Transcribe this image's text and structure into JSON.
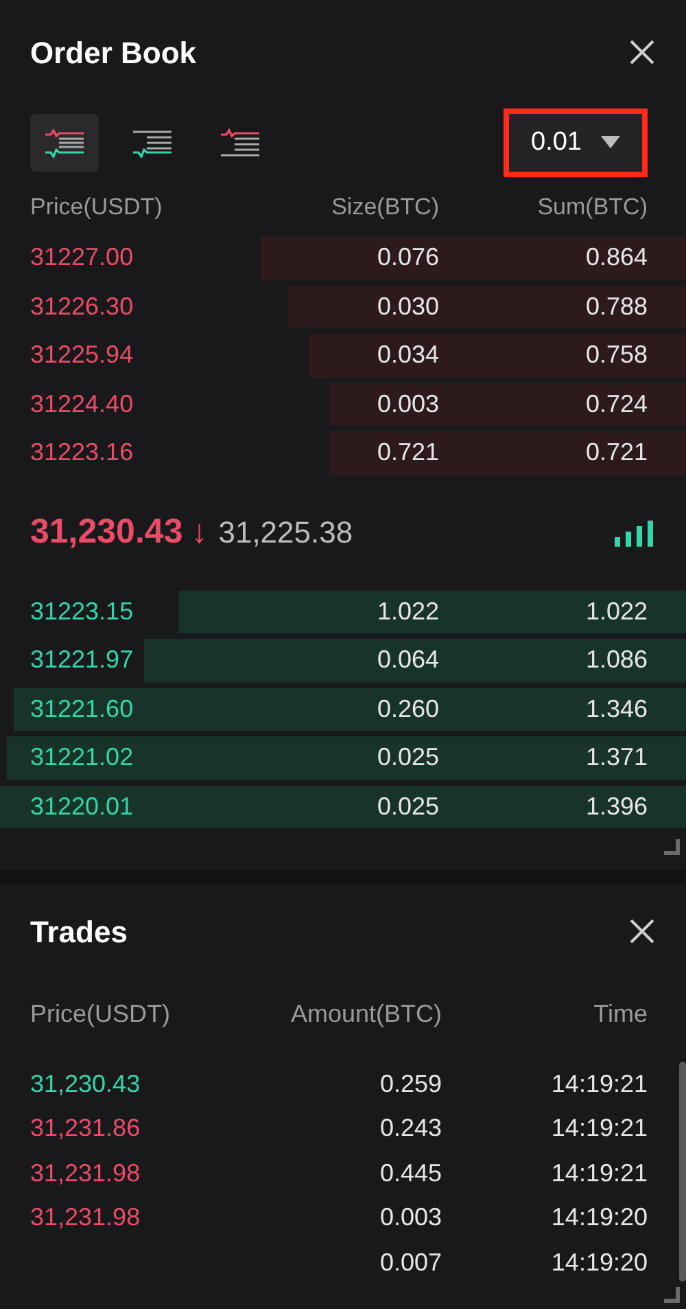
{
  "order_book": {
    "title": "Order Book",
    "view_modes": [
      {
        "kind": "both",
        "selected": true
      },
      {
        "kind": "bids",
        "selected": false
      },
      {
        "kind": "asks",
        "selected": false
      }
    ],
    "precision": {
      "value": "0.01",
      "highlighted": true
    },
    "columns": [
      "Price(USDT)",
      "Size(BTC)",
      "Sum(BTC)"
    ],
    "asks": [
      {
        "price": "31227.00",
        "size": "0.076",
        "sum": "0.864"
      },
      {
        "price": "31226.30",
        "size": "0.030",
        "sum": "0.788"
      },
      {
        "price": "31225.94",
        "size": "0.034",
        "sum": "0.758"
      },
      {
        "price": "31224.40",
        "size": "0.003",
        "sum": "0.724"
      },
      {
        "price": "31223.16",
        "size": "0.721",
        "sum": "0.721"
      }
    ],
    "last_price": {
      "price": "31,230.43",
      "arrow": "↓",
      "mark_price": "31,225.38"
    },
    "bids": [
      {
        "price": "31223.15",
        "size": "1.022",
        "sum": "1.022"
      },
      {
        "price": "31221.97",
        "size": "0.064",
        "sum": "1.086"
      },
      {
        "price": "31221.60",
        "size": "0.260",
        "sum": "1.346"
      },
      {
        "price": "31221.02",
        "size": "0.025",
        "sum": "1.371"
      },
      {
        "price": "31220.01",
        "size": "0.025",
        "sum": "1.396"
      }
    ]
  },
  "trades": {
    "title": "Trades",
    "columns": [
      "Price(USDT)",
      "Amount(BTC)",
      "Time"
    ],
    "rows": [
      {
        "price": "31,230.43",
        "color": "#32d6a7",
        "amount": "0.259",
        "time": "14:19:21"
      },
      {
        "price": "31,231.86",
        "color": "#ec4b67",
        "amount": "0.243",
        "time": "14:19:21"
      },
      {
        "price": "31,231.98",
        "color": "#ec4b67",
        "amount": "0.445",
        "time": "14:19:21"
      },
      {
        "price": "31,231.98",
        "color": "#ec4b67",
        "amount": "0.003",
        "time": "14:19:20"
      },
      {
        "amount": "0.007",
        "time": "14:19:20"
      }
    ]
  }
}
